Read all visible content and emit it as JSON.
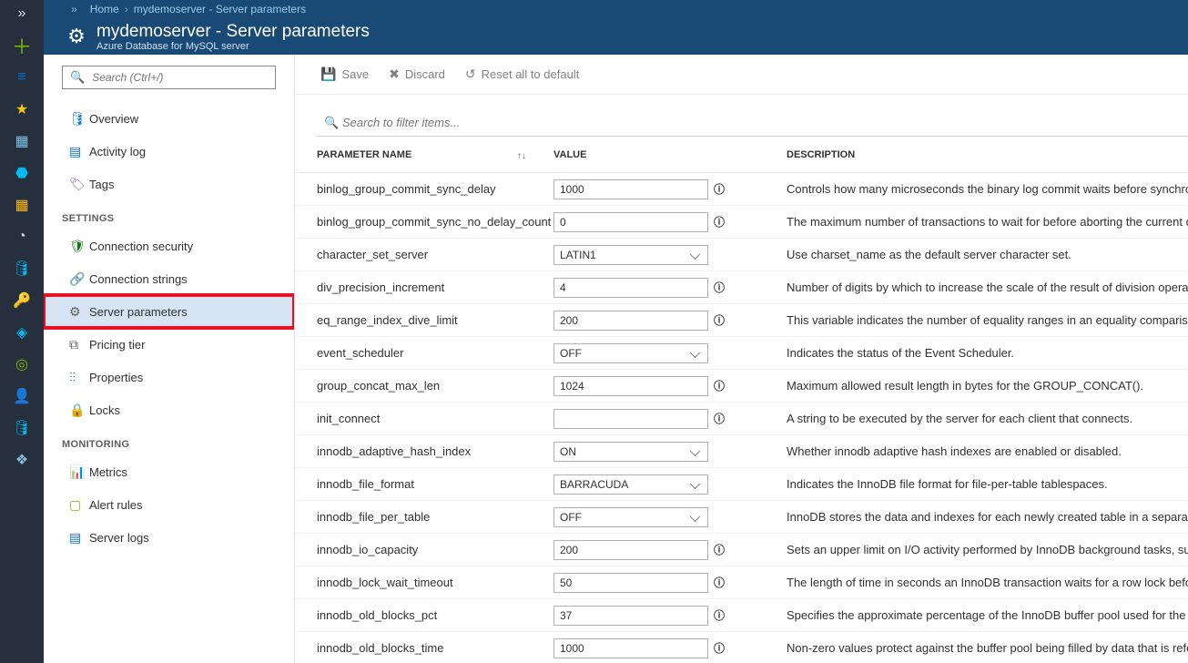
{
  "breadcrumb": {
    "home": "Home",
    "current": "mydemoserver - Server parameters"
  },
  "header": {
    "title": "mydemoserver - Server parameters",
    "subtitle": "Azure Database for MySQL server"
  },
  "search": {
    "placeholder": "Search (Ctrl+/)"
  },
  "sidebar": {
    "items": [
      {
        "label": "Overview"
      },
      {
        "label": "Activity log"
      },
      {
        "label": "Tags"
      }
    ],
    "settings_header": "SETTINGS",
    "settings": [
      {
        "label": "Connection security"
      },
      {
        "label": "Connection strings"
      },
      {
        "label": "Server parameters"
      },
      {
        "label": "Pricing tier"
      },
      {
        "label": "Properties"
      },
      {
        "label": "Locks"
      }
    ],
    "monitoring_header": "MONITORING",
    "monitoring": [
      {
        "label": "Metrics"
      },
      {
        "label": "Alert rules"
      },
      {
        "label": "Server logs"
      }
    ]
  },
  "toolbar": {
    "save": "Save",
    "discard": "Discard",
    "reset": "Reset all to default"
  },
  "filter": {
    "placeholder": "Search to filter items..."
  },
  "columns": {
    "name": "PARAMETER NAME",
    "value": "VALUE",
    "desc": "DESCRIPTION"
  },
  "params": [
    {
      "name": "binlog_group_commit_sync_delay",
      "type": "text",
      "value": "1000",
      "desc": "Controls how many microseconds the binary log commit waits before synchronizin"
    },
    {
      "name": "binlog_group_commit_sync_no_delay_count",
      "type": "text",
      "value": "0",
      "desc": "The maximum number of transactions to wait for before aborting the current dela"
    },
    {
      "name": "character_set_server",
      "type": "select",
      "value": "LATIN1",
      "desc": "Use charset_name as the default server character set."
    },
    {
      "name": "div_precision_increment",
      "type": "text",
      "value": "4",
      "desc": "Number of digits by which to increase the scale of the result of division operations"
    },
    {
      "name": "eq_range_index_dive_limit",
      "type": "text",
      "value": "200",
      "desc": "This variable indicates the number of equality ranges in an equality comparison co"
    },
    {
      "name": "event_scheduler",
      "type": "select",
      "value": "OFF",
      "desc": "Indicates the status of the Event Scheduler."
    },
    {
      "name": "group_concat_max_len",
      "type": "text",
      "value": "1024",
      "desc": "Maximum allowed result length in bytes for the GROUP_CONCAT()."
    },
    {
      "name": "init_connect",
      "type": "text",
      "value": "",
      "desc": "A string to be executed by the server for each client that connects."
    },
    {
      "name": "innodb_adaptive_hash_index",
      "type": "select",
      "value": "ON",
      "desc": "Whether innodb adaptive hash indexes are enabled or disabled."
    },
    {
      "name": "innodb_file_format",
      "type": "select",
      "value": "BARRACUDA",
      "desc": "Indicates the InnoDB file format for file-per-table tablespaces."
    },
    {
      "name": "innodb_file_per_table",
      "type": "select",
      "value": "OFF",
      "desc": "InnoDB stores the data and indexes for each newly created table in a separate .ibd"
    },
    {
      "name": "innodb_io_capacity",
      "type": "text",
      "value": "200",
      "desc": "Sets an upper limit on I/O activity performed by InnoDB background tasks, such as"
    },
    {
      "name": "innodb_lock_wait_timeout",
      "type": "text",
      "value": "50",
      "desc": "The length of time in seconds an InnoDB transaction waits for a row lock before gi"
    },
    {
      "name": "innodb_old_blocks_pct",
      "type": "text",
      "value": "37",
      "desc": "Specifies the approximate percentage of the InnoDB buffer pool used for the old b"
    },
    {
      "name": "innodb_old_blocks_time",
      "type": "text",
      "value": "1000",
      "desc": "Non-zero values protect against the buffer pool being filled by data that is referen"
    }
  ]
}
